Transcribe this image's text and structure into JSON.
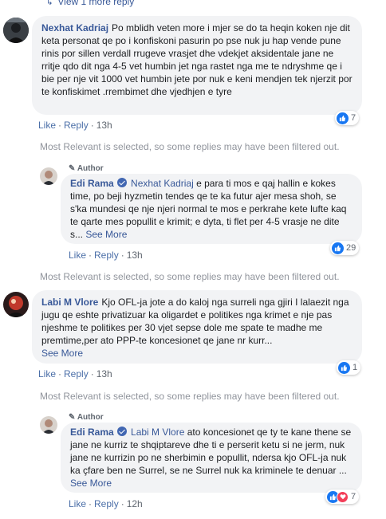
{
  "top": {
    "view_more": "View 1 more reply"
  },
  "filter_note": "Most Relevant is selected, so some replies may have been filtered out.",
  "actions": {
    "like": "Like",
    "reply": "Reply",
    "sep": "·"
  },
  "author_badge": "Author",
  "see_more": "See More",
  "comments": [
    {
      "author": "Nexhat Kadriaj",
      "text": "Po mblidh veten more i mjer se do ta heqin koken nje dit keta personat qe po i konfiskoni pasurin po pse nuk ju hap vende pune rinis por sillen verdall rrugeve vrasjet dhe vdekjet aksidentale jane ne rritje qdo dit nga 4-5 vet humbin jet nga rastet nga me te ndryshme qe i bie per nje vit 1000 vet humbin jete por nuk e keni mendjen tek njerzit por te konfiskimet .rrembimet dhe vjedhjen e tyre",
      "time": "13h",
      "reactions": "7"
    },
    {
      "author": "Edi Rama",
      "mention": "Nexhat Kadriaj",
      "text": " e para ti mos e qaj hallin e kokes time, po beji hyzmetin tendes qe te ka futur ajer mesa shoh, se s'ka mundesi qe nje njeri normal te mos e perkrahe kete lufte kaq te qarte mes popullit e krimit; e dyta, ti flet per 4-5 vrasje ne dite s... ",
      "time": "13h",
      "reactions": "29"
    },
    {
      "author": "Labi M Vlore",
      "text": "Kjo OFL-ja jote a do kaloj nga surreli nga gjiri I lalaezit nga jugu qe eshte privatizuar ka oligardet e politikes nga krimet e nje pas njeshme te politikes per 30 vjet sepse dole me spate te madhe me premtime,per ato PPP-te koncesionet qe jane nr kurr...",
      "time": "13h",
      "reactions": "1"
    },
    {
      "author": "Edi Rama",
      "mention": "Labi M Vlore",
      "text": " ato koncesionet qe ty te kane thene se jane ne kurriz te shqiptareve dhe ti e perserit ketu si ne jerm, nuk jane ne kurrizin po ne sherbimin e popullit, ndersa kjo OFL-ja nuk ka çfare ben ne Surrel, se ne Surrel nuk ka kriminele te denuar ... ",
      "time": "12h",
      "reactions": "7"
    }
  ]
}
